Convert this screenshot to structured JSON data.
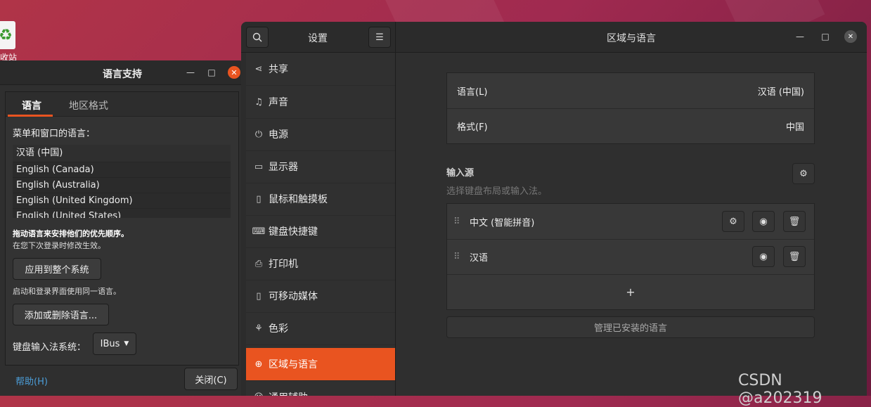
{
  "desktop": {
    "trash_label": "收站",
    "watermark": "CSDN @a202319"
  },
  "language_support": {
    "title": "语言支持",
    "tabs": [
      {
        "label": "语言",
        "active": true
      },
      {
        "label": "地区格式",
        "active": false
      }
    ],
    "menu_label": "菜单和窗口的语言：",
    "languages": [
      "汉语 (中国)",
      "English (Canada)",
      "English (Australia)",
      "English (United Kingdom)",
      "English (United States)"
    ],
    "drag_hint": "拖动语言来安排他们的优先顺序。",
    "drag_hint_sub": "在您下次登录时修改生效。",
    "apply_button": "应用到整个系统",
    "apply_hint": "启动和登录界面使用同一语言。",
    "add_remove_button": "添加或删除语言...",
    "input_system_label": "键盘输入法系统：",
    "input_system_value": "IBus",
    "help_link": "帮助(H)",
    "close_button": "关闭(C)"
  },
  "settings": {
    "sidebar_title": "设置",
    "page_title": "区域与语言",
    "sidebar_items": [
      {
        "label": "共享",
        "icon": "share-icon"
      },
      {
        "label": "声音",
        "icon": "music-note-icon"
      },
      {
        "label": "电源",
        "icon": "power-icon"
      },
      {
        "label": "显示器",
        "icon": "monitor-icon"
      },
      {
        "label": "鼠标和触摸板",
        "icon": "mouse-icon"
      },
      {
        "label": "键盘快捷键",
        "icon": "keyboard-icon"
      },
      {
        "label": "打印机",
        "icon": "printer-icon"
      },
      {
        "label": "可移动媒体",
        "icon": "usb-icon"
      },
      {
        "label": "色彩",
        "icon": "color-icon"
      },
      {
        "label": "区域与语言",
        "icon": "globe-icon",
        "active": true
      },
      {
        "label": "通用辅助",
        "icon": "accessibility-icon"
      }
    ],
    "language_row": {
      "label": "语言(L)",
      "value": "汉语 (中国)"
    },
    "format_row": {
      "label": "格式(F)",
      "value": "中国"
    },
    "input_sources_title": "输入源",
    "input_sources_sub": "选择键盘布局或输入法。",
    "input_sources": [
      {
        "label": "中文 (智能拼音)",
        "has_settings": true
      },
      {
        "label": "汉语",
        "has_settings": false
      }
    ],
    "add_symbol": "+",
    "manage_button": "管理已安装的语言"
  },
  "colors": {
    "accent": "#e95420",
    "link": "#4c9ed9"
  }
}
